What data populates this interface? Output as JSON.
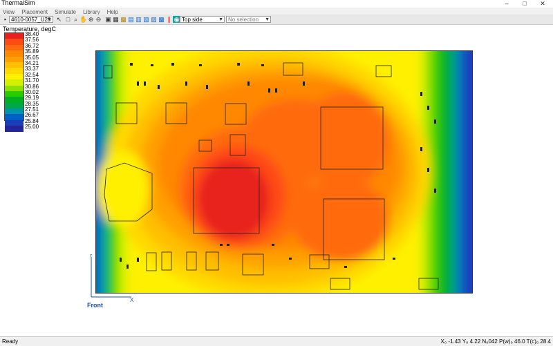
{
  "app": {
    "title": "ThermalSim",
    "window_buttons": [
      "–",
      "□",
      "✕"
    ]
  },
  "menu": [
    "View",
    "Placement",
    "Simulate",
    "Library",
    "Help"
  ],
  "toolbar": {
    "part_select": "4610-0057_U28",
    "view_select": "Top side",
    "selection": "No selection"
  },
  "legend": {
    "title": "Temperature, degC",
    "values": [
      "38.40",
      "37.56",
      "36.72",
      "35.89",
      "35.05",
      "34.21",
      "33.37",
      "32.54",
      "31.70",
      "30.86",
      "30.02",
      "29.19",
      "28.35",
      "27.51",
      "26.67",
      "25.84",
      "25.00"
    ],
    "colors": [
      "#e8201e",
      "#ff4a14",
      "#ff6a10",
      "#ff8800",
      "#ffa000",
      "#ffbe00",
      "#ffd800",
      "#fff000",
      "#d2f000",
      "#8ee000",
      "#28cc00",
      "#00b020",
      "#00a848",
      "#0094a8",
      "#0060c8",
      "#1a3eb8",
      "#25249a"
    ]
  },
  "axes": {
    "y_label": "Y",
    "x_label": "X",
    "front_label": "Front"
  },
  "status": {
    "left": "Ready",
    "right": "X₀ -1.43  Y₀ 4.22  N₀042  P(w)₀ 46.0  T(c)₀ 28.4"
  }
}
